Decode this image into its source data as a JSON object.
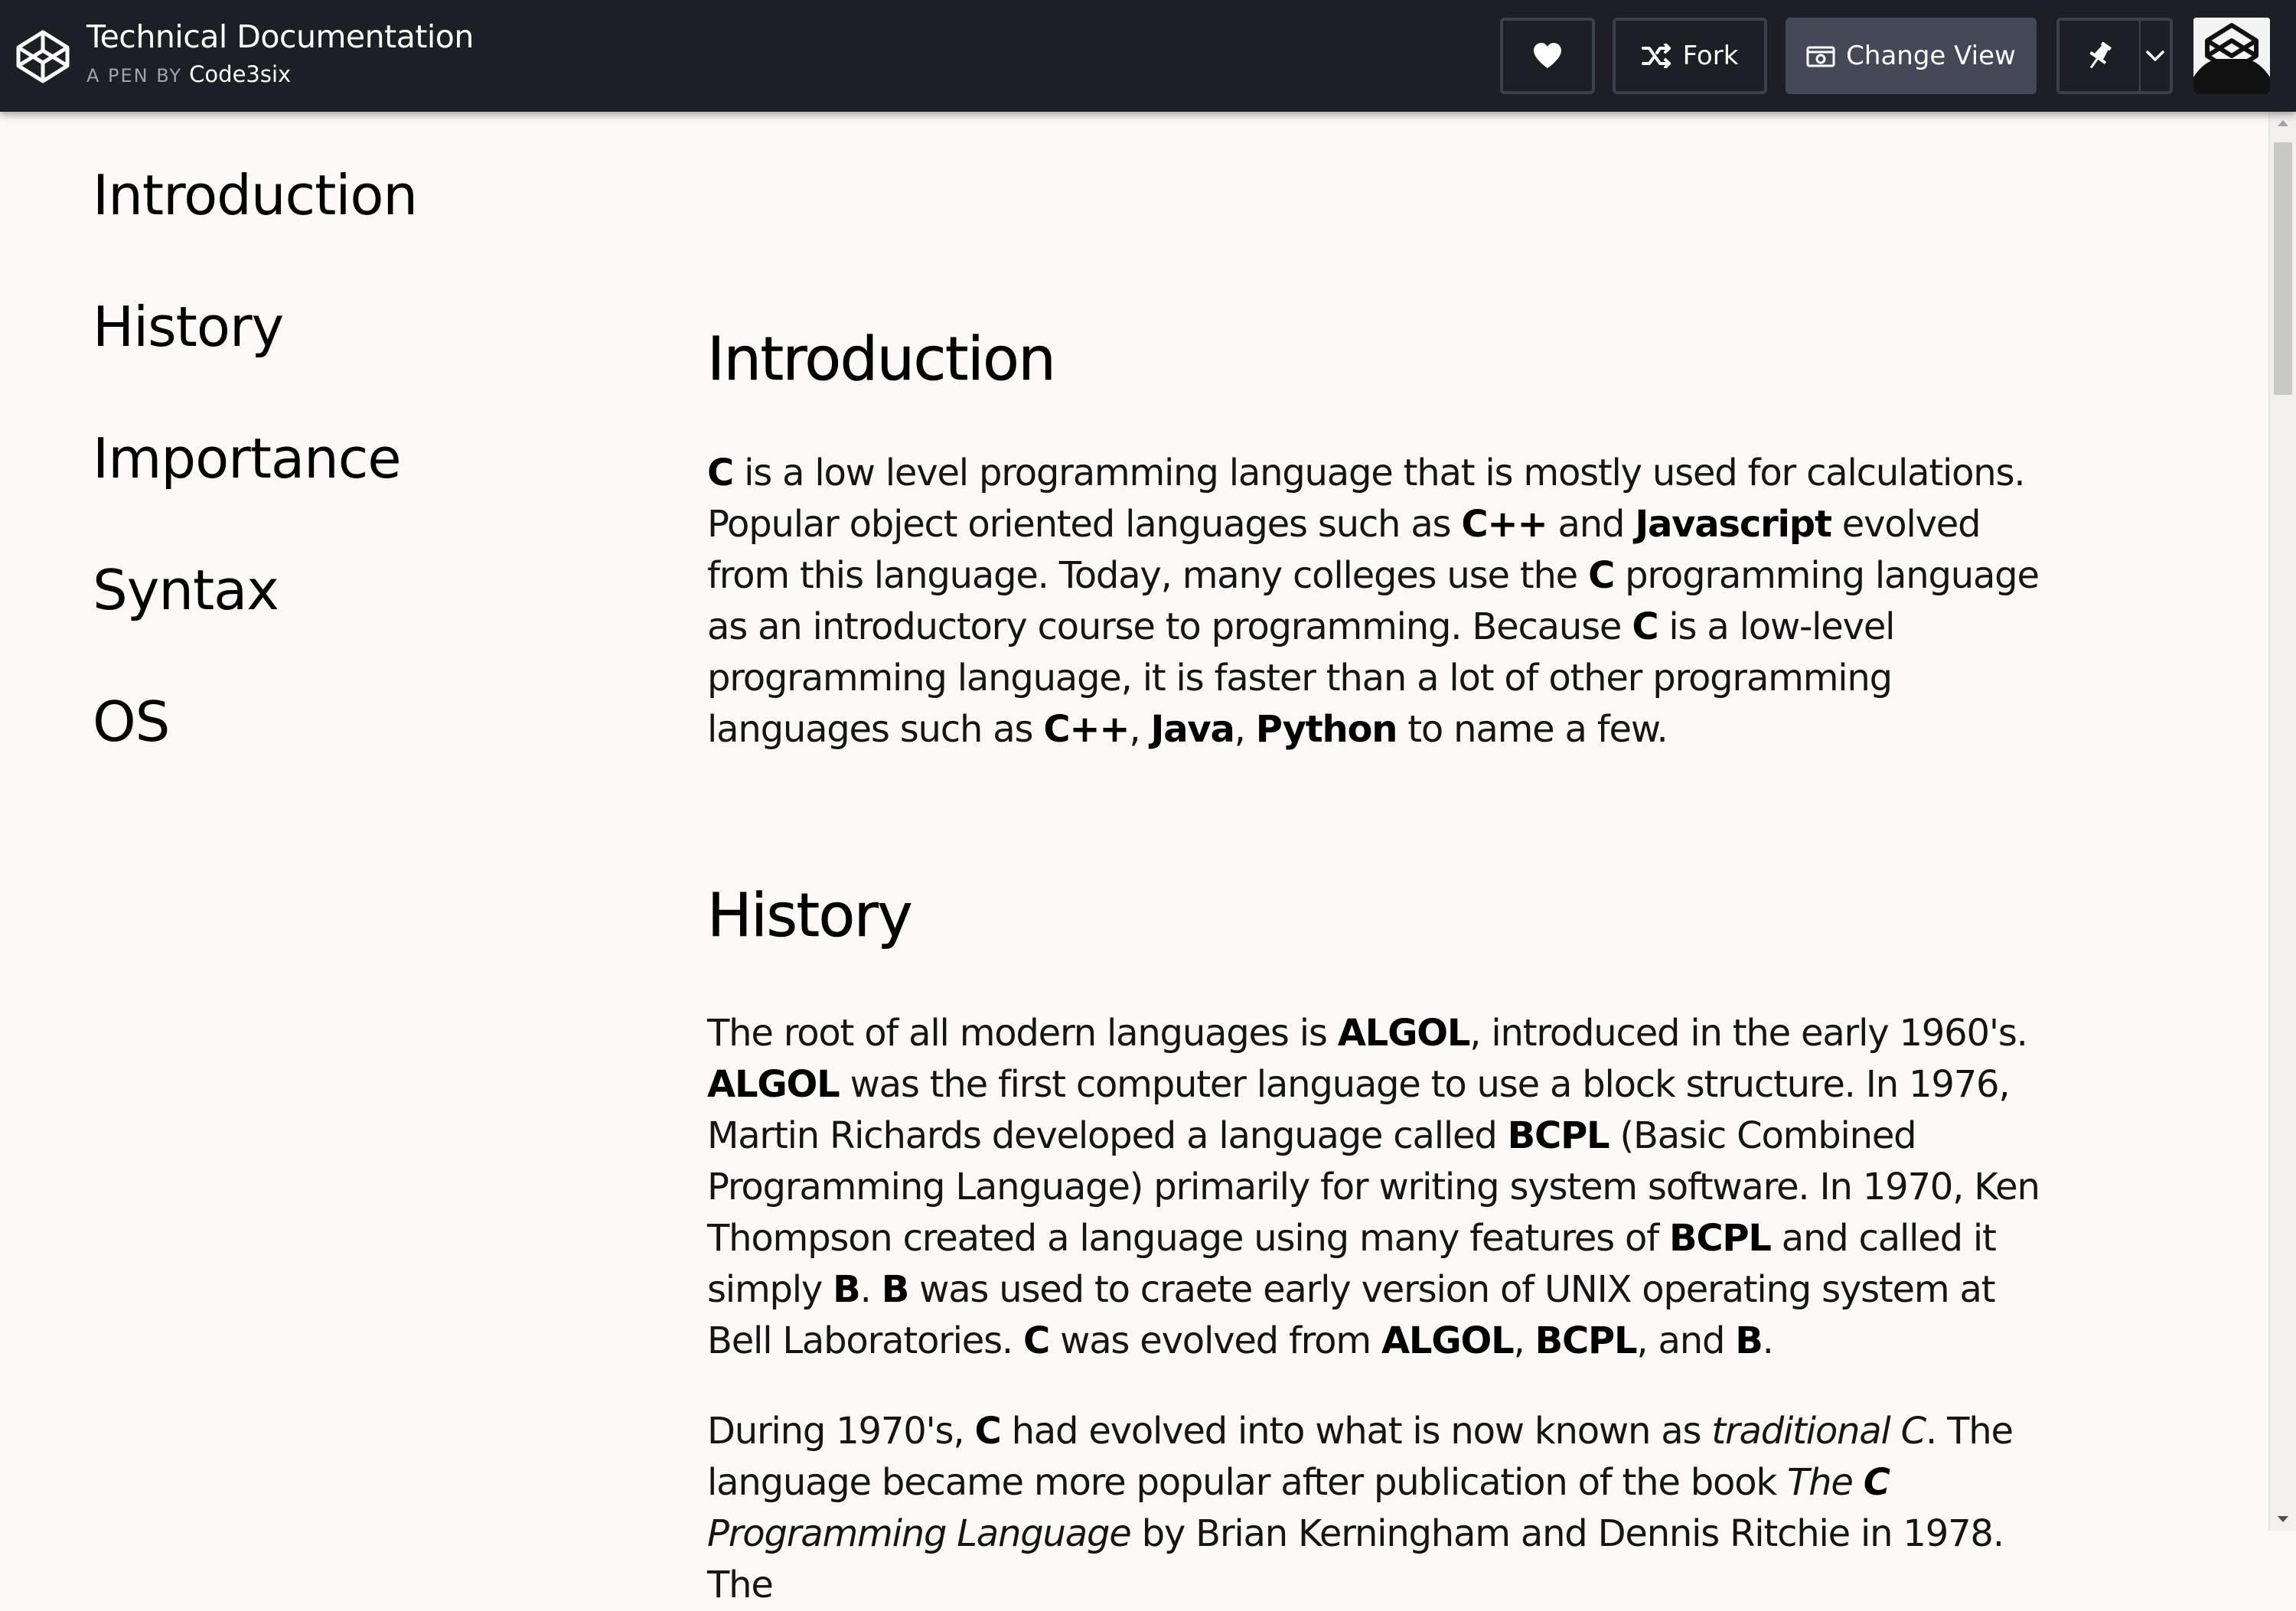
{
  "topbar": {
    "title": "Technical Documentation",
    "by_prefix": "A PEN BY",
    "author": "Code3six",
    "buttons": {
      "heart_icon": "heart-icon",
      "fork_label": "Fork",
      "change_view_label": "Change View",
      "pin_icon": "pin-icon",
      "caret_icon": "chevron-down-icon"
    },
    "colors": {
      "bar": "#1e1f26",
      "button_border": "#3c3f4c",
      "active_button": "#444857"
    }
  },
  "nav": {
    "items": [
      {
        "label": "Introduction"
      },
      {
        "label": "History"
      },
      {
        "label": "Importance"
      },
      {
        "label": "Syntax"
      },
      {
        "label": "OS"
      }
    ]
  },
  "main": {
    "intro": {
      "title": "Introduction",
      "p1": [
        {
          "b": "C"
        },
        {
          "t": " is a low level programming language that is mostly used for calculations. Popular object oriented languages such as "
        },
        {
          "b": "C++"
        },
        {
          "t": " and "
        },
        {
          "b": "Javascript"
        },
        {
          "t": " evolved from this language. Today, many colleges use the "
        },
        {
          "b": "C"
        },
        {
          "t": " programming language as an introductory course to programming. Because "
        },
        {
          "b": "C"
        },
        {
          "t": " is a low-level programming language, it is faster than a lot of other programming languages such as "
        },
        {
          "b": "C++"
        },
        {
          "t": ", "
        },
        {
          "b": "Java"
        },
        {
          "t": ", "
        },
        {
          "b": "Python"
        },
        {
          "t": " to name a few."
        }
      ]
    },
    "history": {
      "title": "History",
      "p1": [
        {
          "t": "The root of all modern languages is "
        },
        {
          "b": "ALGOL"
        },
        {
          "t": ", introduced in the early 1960's. "
        },
        {
          "b": "ALGOL"
        },
        {
          "t": " was the first computer language to use a block structure. In 1976, Martin Richards developed a language called "
        },
        {
          "b": "BCPL"
        },
        {
          "t": " (Basic Combined Programming Language) primarily for writing system software. In 1970, Ken Thompson created a language using many features of "
        },
        {
          "b": "BCPL"
        },
        {
          "t": " and called it simply "
        },
        {
          "b": "B"
        },
        {
          "t": ". "
        },
        {
          "b": "B"
        },
        {
          "t": " was used to craete early version of UNIX operating system at Bell Laboratories. "
        },
        {
          "b": "C"
        },
        {
          "t": " was evolved from "
        },
        {
          "b": "ALGOL"
        },
        {
          "t": ", "
        },
        {
          "b": "BCPL"
        },
        {
          "t": ", and "
        },
        {
          "b": "B"
        },
        {
          "t": "."
        }
      ],
      "p2": [
        {
          "t": "During 1970's, "
        },
        {
          "b": "C"
        },
        {
          "t": " had evolved into what is now known as "
        },
        {
          "i": "traditional C"
        },
        {
          "t": ". The language became more popular after publication of the book "
        },
        {
          "i": "The "
        },
        {
          "bi": "C"
        },
        {
          "i": " Programming Language"
        },
        {
          "t": " by Brian Kerningham and Dennis Ritchie in 1978. The"
        }
      ]
    }
  }
}
